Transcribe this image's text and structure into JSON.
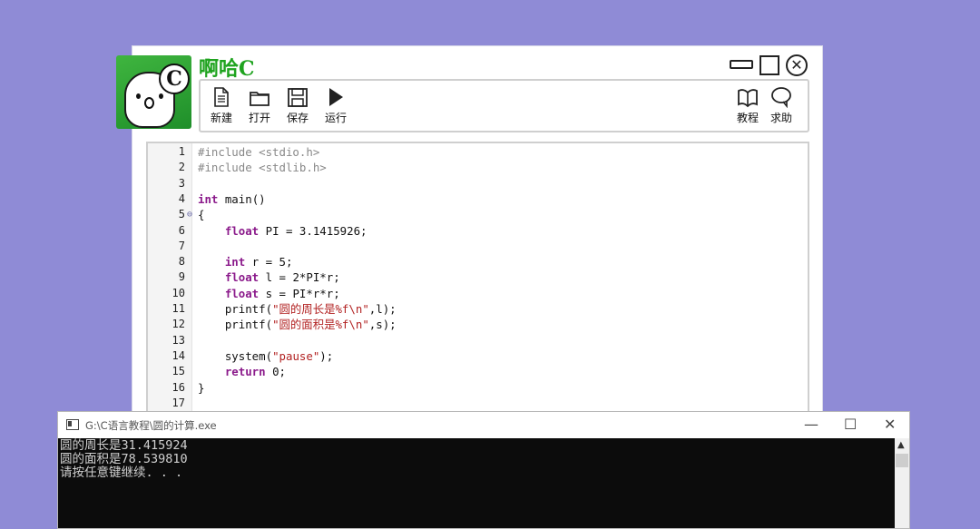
{
  "app": {
    "title": "啊哈C",
    "logo_letter": "C"
  },
  "toolbar": {
    "new": "新建",
    "open": "打开",
    "save": "保存",
    "run": "运行",
    "tutorial": "教程",
    "help": "求助"
  },
  "editor": {
    "lines": [
      {
        "n": "1",
        "t": "#include <stdio.h>"
      },
      {
        "n": "2",
        "t": "#include <stdlib.h>"
      },
      {
        "n": "3",
        "t": ""
      },
      {
        "n": "4",
        "t": "int main()"
      },
      {
        "n": "5",
        "t": "{"
      },
      {
        "n": "6",
        "t": "    float PI = 3.1415926;"
      },
      {
        "n": "7",
        "t": ""
      },
      {
        "n": "8",
        "t": "    int r = 5;"
      },
      {
        "n": "9",
        "t": "    float l = 2*PI*r;"
      },
      {
        "n": "10",
        "t": "    float s = PI*r*r;"
      },
      {
        "n": "11",
        "t": "    printf(\"圆的周长是%f\\n\",l);"
      },
      {
        "n": "12",
        "t": "    printf(\"圆的面积是%f\\n\",s);"
      },
      {
        "n": "13",
        "t": ""
      },
      {
        "n": "14",
        "t": "    system(\"pause\");"
      },
      {
        "n": "15",
        "t": "    return 0;"
      },
      {
        "n": "16",
        "t": "}"
      },
      {
        "n": "17",
        "t": ""
      }
    ]
  },
  "console": {
    "title": "G:\\C语言教程\\圆的计算.exe",
    "output": [
      "圆的周长是31.415924",
      "圆的面积是78.539810",
      "请按任意键继续. . ."
    ]
  },
  "colors": {
    "background": "#8f8bd6",
    "brand_green": "#1fa31f",
    "keyword": "#8b1a8b",
    "string": "#b22222"
  }
}
